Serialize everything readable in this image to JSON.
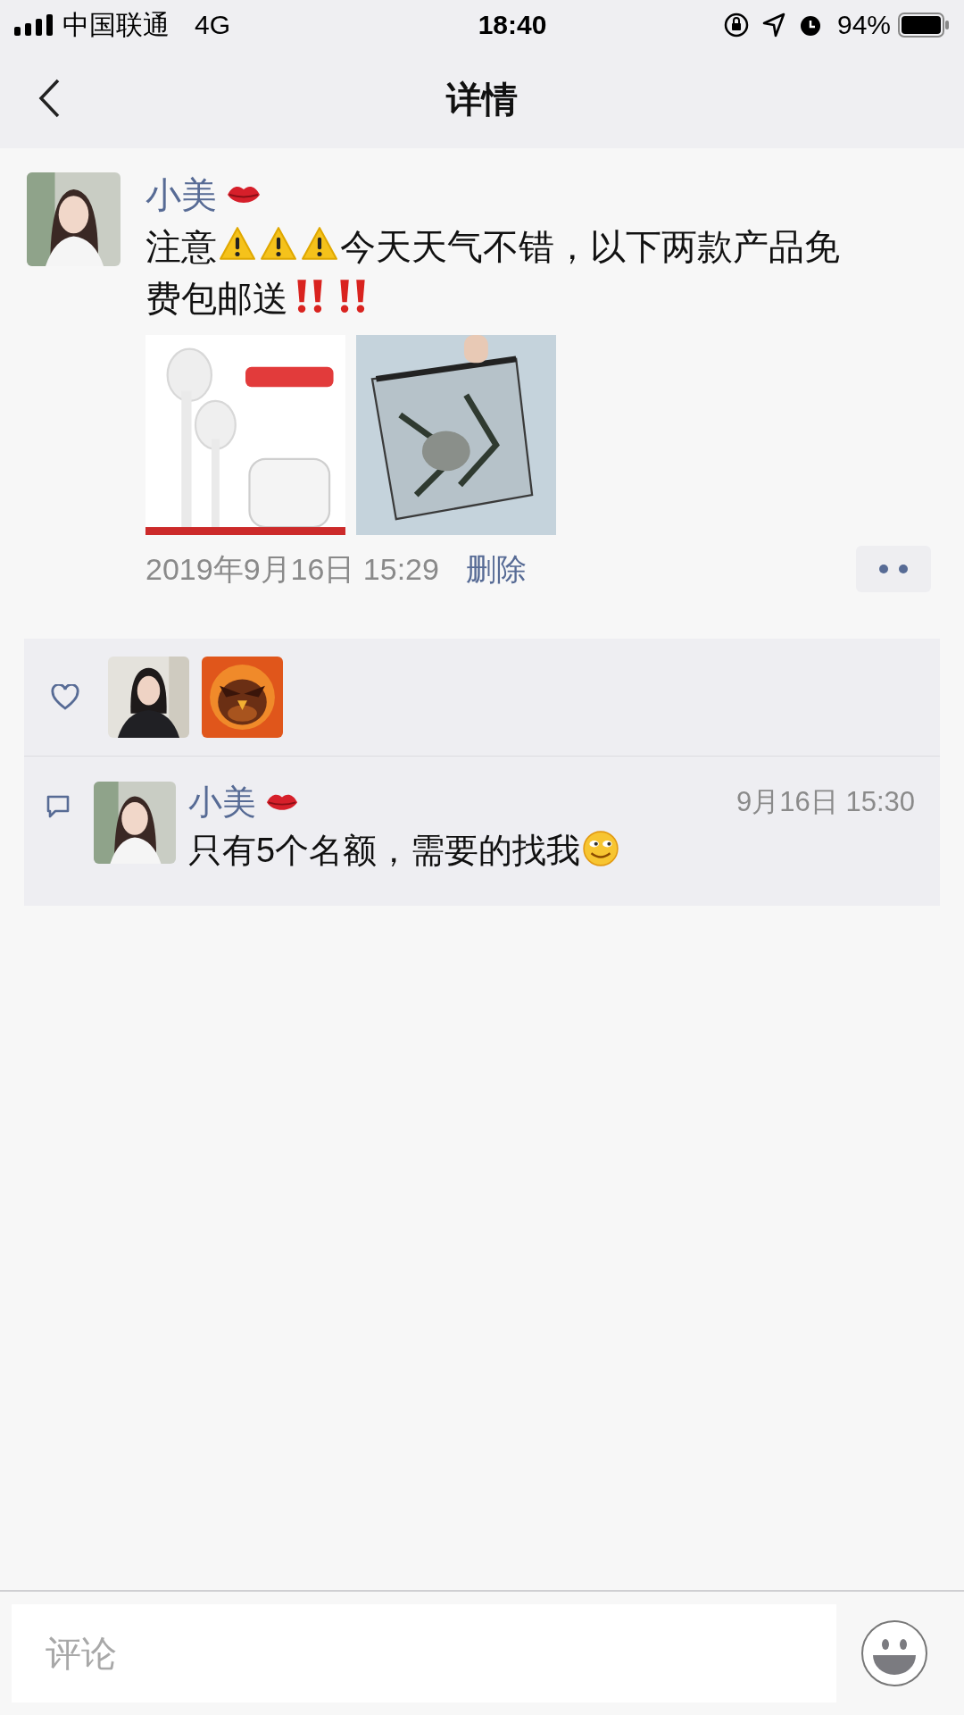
{
  "status_bar": {
    "carrier": "中国联通",
    "network": "4G",
    "time": "18:40",
    "battery": "94%"
  },
  "nav": {
    "title": "详情"
  },
  "post": {
    "author": [
      {
        "kind": "text",
        "text": "小美"
      },
      {
        "kind": "lips"
      }
    ],
    "content": [
      {
        "kind": "text",
        "text": "注意"
      },
      {
        "kind": "warning"
      },
      {
        "kind": "warning"
      },
      {
        "kind": "warning"
      },
      {
        "kind": "text",
        "text": "今天天气不错，以下两款产品免费包邮送"
      },
      {
        "kind": "bang"
      },
      {
        "kind": "bang"
      }
    ],
    "time": "2019年9月16日 15:29",
    "delete_label": "删除"
  },
  "comments": [
    {
      "author": [
        {
          "kind": "text",
          "text": "小美"
        },
        {
          "kind": "lips"
        }
      ],
      "time": "9月16日 15:30",
      "content": [
        {
          "kind": "text",
          "text": "只有5个名额，需要的找我"
        },
        {
          "kind": "smirk"
        }
      ]
    }
  ],
  "comment_bar": {
    "placeholder": "评论"
  }
}
